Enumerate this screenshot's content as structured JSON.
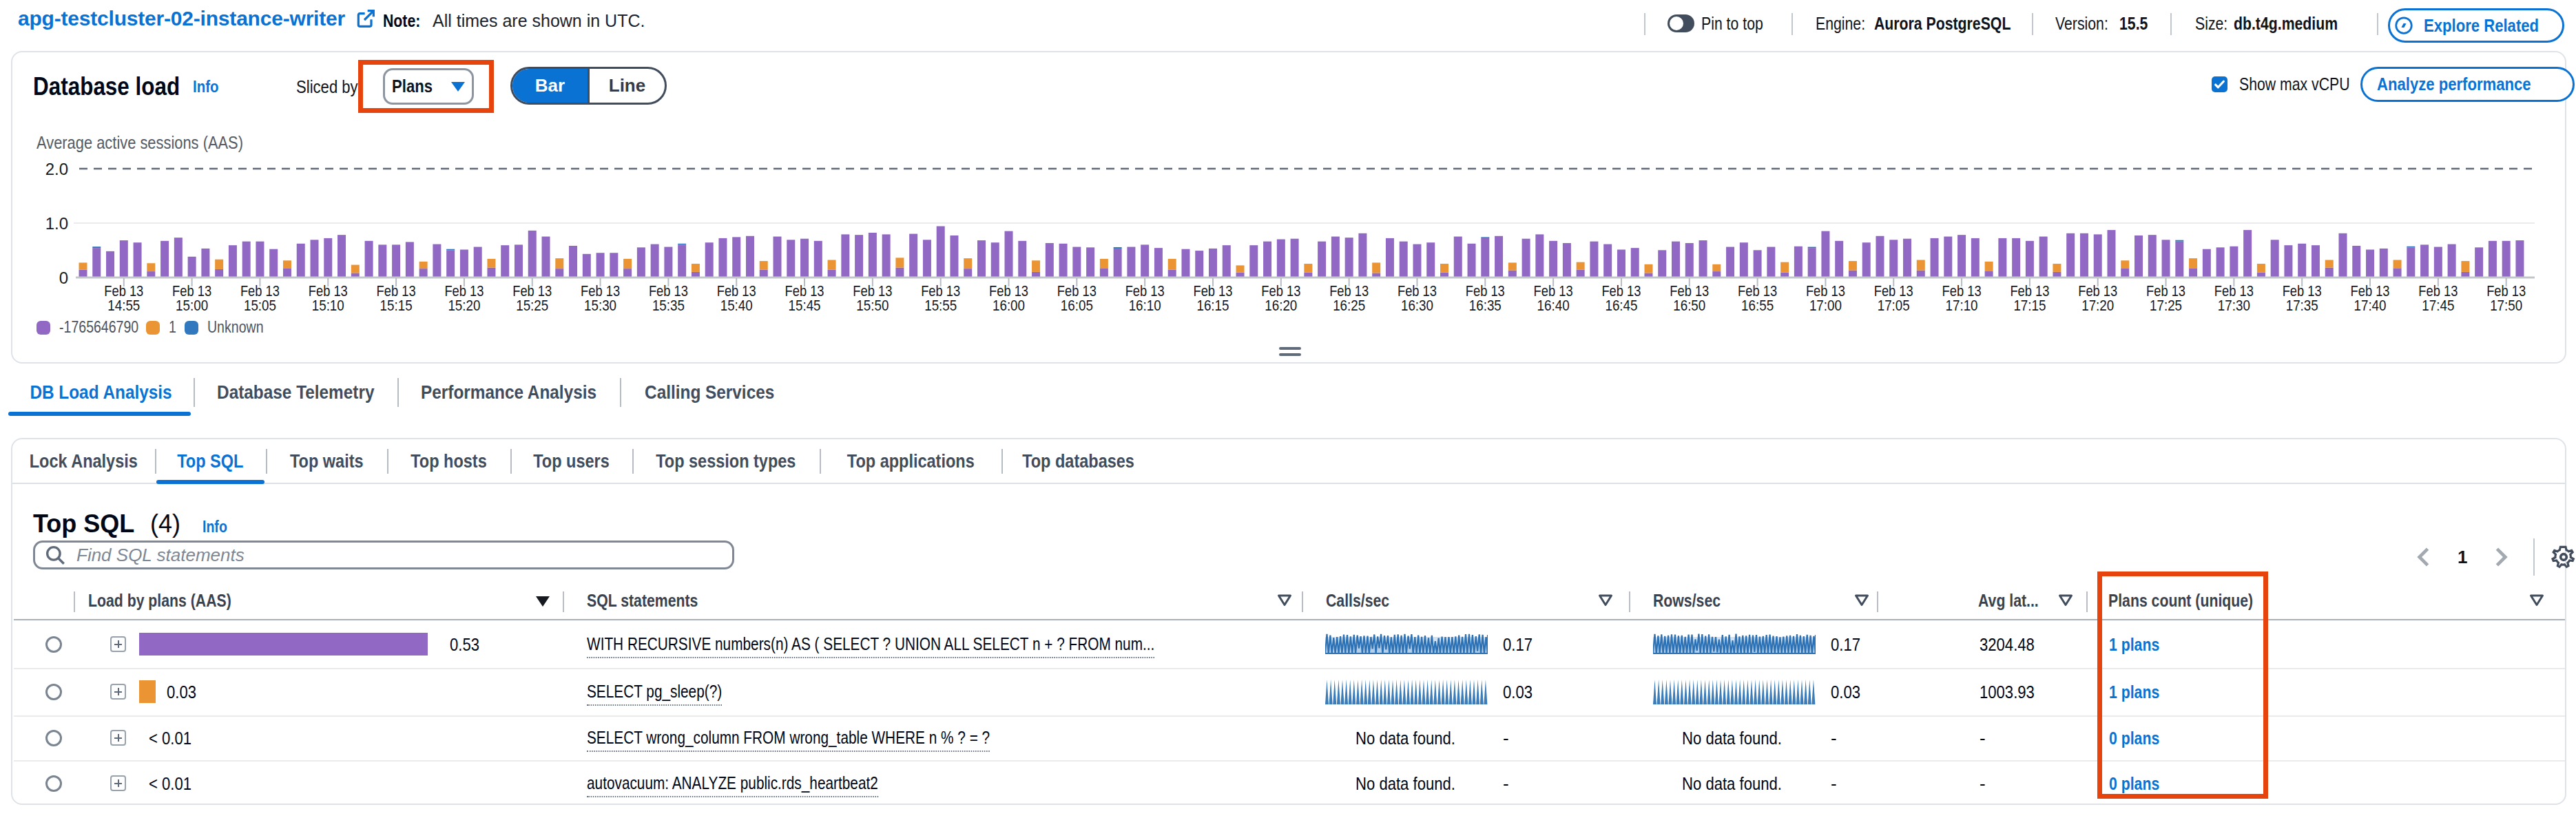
{
  "header": {
    "title": "apg-testcluster-02-instance-writer",
    "note_label": "Note:",
    "note_text": "All times are shown in UTC.",
    "pin_label": "Pin to top",
    "engine_label": "Engine:",
    "engine_value": "Aurora PostgreSQL",
    "version_label": "Version:",
    "version_value": "15.5",
    "size_label": "Size:",
    "size_value": "db.t4g.medium",
    "explore_button": "Explore Related"
  },
  "load_panel": {
    "title": "Database load",
    "info_label": "Info",
    "sliced_by_label": "Sliced by",
    "slice_value": "Plans",
    "bar_label": "Bar",
    "line_label": "Line",
    "show_max_label": "Show max vCPU",
    "analyze_button": "Analyze performance"
  },
  "chart_data": {
    "type": "bar",
    "stacked": true,
    "ylabel": "Average active sessions (AAS)",
    "ylim": [
      0,
      2.0
    ],
    "y_ticks": [
      "0",
      "1.0",
      "2.0"
    ],
    "max_vcpu_threshold": 2.0,
    "grid": "horizontal",
    "legend_position": "bottom-left",
    "x_tick_date": "Feb 13",
    "x_ticks": [
      "14:55",
      "15:00",
      "15:05",
      "15:10",
      "15:15",
      "15:20",
      "15:25",
      "15:30",
      "15:35",
      "15:40",
      "15:45",
      "15:50",
      "15:55",
      "16:00",
      "16:05",
      "16:10",
      "16:15",
      "16:20",
      "16:25",
      "16:30",
      "16:35",
      "16:40",
      "16:45",
      "16:50",
      "16:55",
      "17:00",
      "17:05",
      "17:10",
      "17:15",
      "17:20",
      "17:25",
      "17:30",
      "17:35",
      "17:40",
      "17:45",
      "17:50"
    ],
    "bar_interval_minutes": 1,
    "series": [
      {
        "name": "-1765646790",
        "color": "#9268c5"
      },
      {
        "name": "1",
        "color": "#eb9433"
      },
      {
        "name": "Unknown",
        "color": "#3178bf"
      }
    ],
    "bars": [
      [
        0.13,
        0.13,
        0
      ],
      [
        0.53,
        0,
        0.025
      ],
      [
        0.47,
        0,
        0
      ],
      [
        0.67,
        0,
        0
      ],
      [
        0.63,
        0,
        0
      ],
      [
        0.1,
        0.15,
        0
      ],
      [
        0.66,
        0,
        0
      ],
      [
        0.72,
        0,
        0
      ],
      [
        0.37,
        0,
        0
      ],
      [
        0.52,
        0,
        0
      ],
      [
        0.14,
        0.18,
        0
      ],
      [
        0.58,
        0,
        0
      ],
      [
        0.65,
        0,
        0
      ],
      [
        0.65,
        0,
        0
      ],
      [
        0.51,
        0,
        0
      ],
      [
        0.16,
        0.14,
        0
      ],
      [
        0.61,
        0,
        0
      ],
      [
        0.68,
        0,
        0
      ],
      [
        0.71,
        0,
        0
      ],
      [
        0.77,
        0,
        0
      ],
      [
        0.07,
        0.15,
        0
      ],
      [
        0.66,
        0,
        0
      ],
      [
        0.59,
        0,
        0
      ],
      [
        0.59,
        0,
        0
      ],
      [
        0.64,
        0,
        0
      ],
      [
        0.15,
        0.13,
        0
      ],
      [
        0.6,
        0,
        0
      ],
      [
        0.49,
        0,
        0.02
      ],
      [
        0.5,
        0,
        0
      ],
      [
        0.55,
        0,
        0
      ],
      [
        0.17,
        0.16,
        0
      ],
      [
        0.58,
        0,
        0
      ],
      [
        0.59,
        0,
        0
      ],
      [
        0.85,
        0,
        0
      ],
      [
        0.74,
        0,
        0
      ],
      [
        0.15,
        0.19,
        0
      ],
      [
        0.57,
        0,
        0
      ],
      [
        0.42,
        0,
        0
      ],
      [
        0.44,
        0,
        0
      ],
      [
        0.44,
        0,
        0
      ],
      [
        0.15,
        0.18,
        0
      ],
      [
        0.54,
        0,
        0
      ],
      [
        0.6,
        0,
        0
      ],
      [
        0.55,
        0,
        0
      ],
      [
        0.59,
        0,
        0.02
      ],
      [
        0.09,
        0.15,
        0
      ],
      [
        0.63,
        0,
        0
      ],
      [
        0.71,
        0,
        0
      ],
      [
        0.73,
        0,
        0
      ],
      [
        0.75,
        0,
        0
      ],
      [
        0.13,
        0.16,
        0
      ],
      [
        0.74,
        0,
        0
      ],
      [
        0.68,
        0,
        0
      ],
      [
        0.7,
        0,
        0
      ],
      [
        0.66,
        0,
        0
      ],
      [
        0.13,
        0.18,
        0
      ],
      [
        0.78,
        0,
        0
      ],
      [
        0.77,
        0,
        0
      ],
      [
        0.81,
        0,
        0
      ],
      [
        0.78,
        0,
        0
      ],
      [
        0.17,
        0.18,
        0
      ],
      [
        0.79,
        0,
        0
      ],
      [
        0.68,
        0,
        0
      ],
      [
        0.93,
        0,
        0
      ],
      [
        0.76,
        0,
        0
      ],
      [
        0.15,
        0.19,
        0
      ],
      [
        0.67,
        0,
        0
      ],
      [
        0.63,
        0,
        0
      ],
      [
        0.84,
        0,
        0
      ],
      [
        0.66,
        0,
        0
      ],
      [
        0.09,
        0.21,
        0
      ],
      [
        0.62,
        0,
        0
      ],
      [
        0.61,
        0,
        0
      ],
      [
        0.55,
        0,
        0
      ],
      [
        0.54,
        0,
        0
      ],
      [
        0.16,
        0.17,
        0
      ],
      [
        0.52,
        0,
        0.025
      ],
      [
        0.55,
        0,
        0
      ],
      [
        0.59,
        0,
        0
      ],
      [
        0.53,
        0,
        0
      ],
      [
        0.13,
        0.2,
        0
      ],
      [
        0.51,
        0,
        0
      ],
      [
        0.48,
        0,
        0
      ],
      [
        0.52,
        0,
        0
      ],
      [
        0.58,
        0,
        0
      ],
      [
        0.08,
        0.13,
        0
      ],
      [
        0.58,
        0,
        0
      ],
      [
        0.65,
        0,
        0
      ],
      [
        0.69,
        0,
        0
      ],
      [
        0.7,
        0,
        0
      ],
      [
        0.08,
        0.16,
        0
      ],
      [
        0.65,
        0,
        0
      ],
      [
        0.74,
        0,
        0
      ],
      [
        0.72,
        0,
        0
      ],
      [
        0.8,
        0,
        0
      ],
      [
        0.07,
        0.19,
        0
      ],
      [
        0.71,
        0,
        0
      ],
      [
        0.65,
        0,
        0
      ],
      [
        0.6,
        0,
        0
      ],
      [
        0.63,
        0,
        0
      ],
      [
        0.08,
        0.16,
        0
      ],
      [
        0.74,
        0,
        0
      ],
      [
        0.61,
        0,
        0
      ],
      [
        0.71,
        0,
        0.02
      ],
      [
        0.75,
        0,
        0
      ],
      [
        0.12,
        0.14,
        0
      ],
      [
        0.7,
        0,
        0
      ],
      [
        0.78,
        0,
        0
      ],
      [
        0.66,
        0,
        0
      ],
      [
        0.62,
        0,
        0
      ],
      [
        0.13,
        0.14,
        0
      ],
      [
        0.65,
        0,
        0
      ],
      [
        0.6,
        0,
        0
      ],
      [
        0.5,
        0,
        0
      ],
      [
        0.53,
        0,
        0
      ],
      [
        0.07,
        0.16,
        0
      ],
      [
        0.49,
        0,
        0
      ],
      [
        0.65,
        0,
        0
      ],
      [
        0.62,
        0,
        0
      ],
      [
        0.67,
        0,
        0
      ],
      [
        0.1,
        0.13,
        0
      ],
      [
        0.55,
        0,
        0
      ],
      [
        0.63,
        0,
        0
      ],
      [
        0.49,
        0,
        0
      ],
      [
        0.55,
        0,
        0
      ],
      [
        0.08,
        0.19,
        0
      ],
      [
        0.56,
        0,
        0
      ],
      [
        0.53,
        0,
        0.02
      ],
      [
        0.84,
        0,
        0
      ],
      [
        0.66,
        0,
        0
      ],
      [
        0.12,
        0.17,
        0
      ],
      [
        0.63,
        0,
        0
      ],
      [
        0.75,
        0,
        0
      ],
      [
        0.68,
        0,
        0
      ],
      [
        0.7,
        0,
        0
      ],
      [
        0.12,
        0.19,
        0
      ],
      [
        0.71,
        0,
        0
      ],
      [
        0.74,
        0,
        0
      ],
      [
        0.77,
        0,
        0
      ],
      [
        0.71,
        0,
        0
      ],
      [
        0.11,
        0.17,
        0
      ],
      [
        0.71,
        0,
        0
      ],
      [
        0.71,
        0,
        0
      ],
      [
        0.66,
        0,
        0
      ],
      [
        0.74,
        0,
        0
      ],
      [
        0.09,
        0.15,
        0
      ],
      [
        0.8,
        0,
        0
      ],
      [
        0.8,
        0,
        0
      ],
      [
        0.78,
        0,
        0
      ],
      [
        0.86,
        0,
        0
      ],
      [
        0.16,
        0.14,
        0
      ],
      [
        0.76,
        0,
        0
      ],
      [
        0.77,
        0,
        0
      ],
      [
        0.68,
        0,
        0
      ],
      [
        0.65,
        0,
        0.025
      ],
      [
        0.16,
        0.18,
        0
      ],
      [
        0.51,
        0,
        0
      ],
      [
        0.54,
        0,
        0
      ],
      [
        0.56,
        0,
        0
      ],
      [
        0.86,
        0,
        0
      ],
      [
        0.08,
        0.16,
        0
      ],
      [
        0.68,
        0,
        0
      ],
      [
        0.58,
        0,
        0
      ],
      [
        0.61,
        0,
        0
      ],
      [
        0.58,
        0,
        0
      ],
      [
        0.17,
        0.14,
        0
      ],
      [
        0.8,
        0,
        0
      ],
      [
        0.57,
        0,
        0
      ],
      [
        0.5,
        0,
        0
      ],
      [
        0.52,
        0,
        0
      ],
      [
        0.16,
        0.15,
        0
      ],
      [
        0.54,
        0,
        0.02
      ],
      [
        0.59,
        0,
        0
      ],
      [
        0.55,
        0,
        0
      ],
      [
        0.6,
        0,
        0
      ],
      [
        0.09,
        0.2,
        0
      ],
      [
        0.54,
        0,
        0
      ],
      [
        0.66,
        0,
        0
      ],
      [
        0.66,
        0,
        0
      ],
      [
        0.67,
        0,
        0
      ]
    ]
  },
  "tabs": {
    "main": [
      {
        "label": "DB Load Analysis",
        "active": true
      },
      {
        "label": "Database Telemetry",
        "active": false
      },
      {
        "label": "Performance Analysis",
        "active": false
      },
      {
        "label": "Calling Services",
        "active": false
      }
    ],
    "sub": [
      {
        "label": "Lock Analysis",
        "active": false
      },
      {
        "label": "Top SQL",
        "active": true
      },
      {
        "label": "Top waits",
        "active": false
      },
      {
        "label": "Top hosts",
        "active": false
      },
      {
        "label": "Top users",
        "active": false
      },
      {
        "label": "Top session types",
        "active": false
      },
      {
        "label": "Top applications",
        "active": false
      },
      {
        "label": "Top databases",
        "active": false
      }
    ]
  },
  "table": {
    "title": "Top SQL",
    "count": "(4)",
    "info_label": "Info",
    "search_placeholder": "Find SQL statements",
    "page_number": "1",
    "columns": [
      "Load by plans (AAS)",
      "SQL statements",
      "Calls/sec",
      "Rows/sec",
      "Avg lat...",
      "Plans count (unique)"
    ],
    "no_data_text": "No data found.",
    "empty_value": "-",
    "rows": [
      {
        "load_value": "0.53",
        "load_frac": 1.0,
        "bar_color": "#9268c5",
        "sql": "WITH RECURSIVE numbers(n) AS ( SELECT ? UNION ALL SELECT n + ? FROM num...",
        "calls": "0.17",
        "rows_sec": "0.17",
        "avg_lat": "3204.48",
        "plans": "1 plans",
        "spark": "noisy"
      },
      {
        "load_value": "0.03",
        "load_frac": 0.0566,
        "bar_color": "#eb9433",
        "sql": "SELECT pg_sleep(?)",
        "calls": "0.03",
        "rows_sec": "0.03",
        "avg_lat": "1003.93",
        "plans": "1 plans",
        "spark": "comb"
      },
      {
        "load_value": "< 0.01",
        "load_frac": 0,
        "bar_color": null,
        "sql": "SELECT wrong_column FROM wrong_table WHERE n % ? = ?",
        "calls": null,
        "rows_sec": null,
        "avg_lat": null,
        "plans": "0 plans",
        "spark": null
      },
      {
        "load_value": "< 0.01",
        "load_frac": 0,
        "bar_color": null,
        "sql": "autovacuum: ANALYZE public.rds_heartbeat2",
        "calls": null,
        "rows_sec": null,
        "avg_lat": null,
        "plans": "0 plans",
        "spark": null
      }
    ]
  },
  "annotations": {
    "sliced_by_box": "highlight around Plans dropdown",
    "plans_count_box": "highlight around Plans count (unique) column"
  }
}
